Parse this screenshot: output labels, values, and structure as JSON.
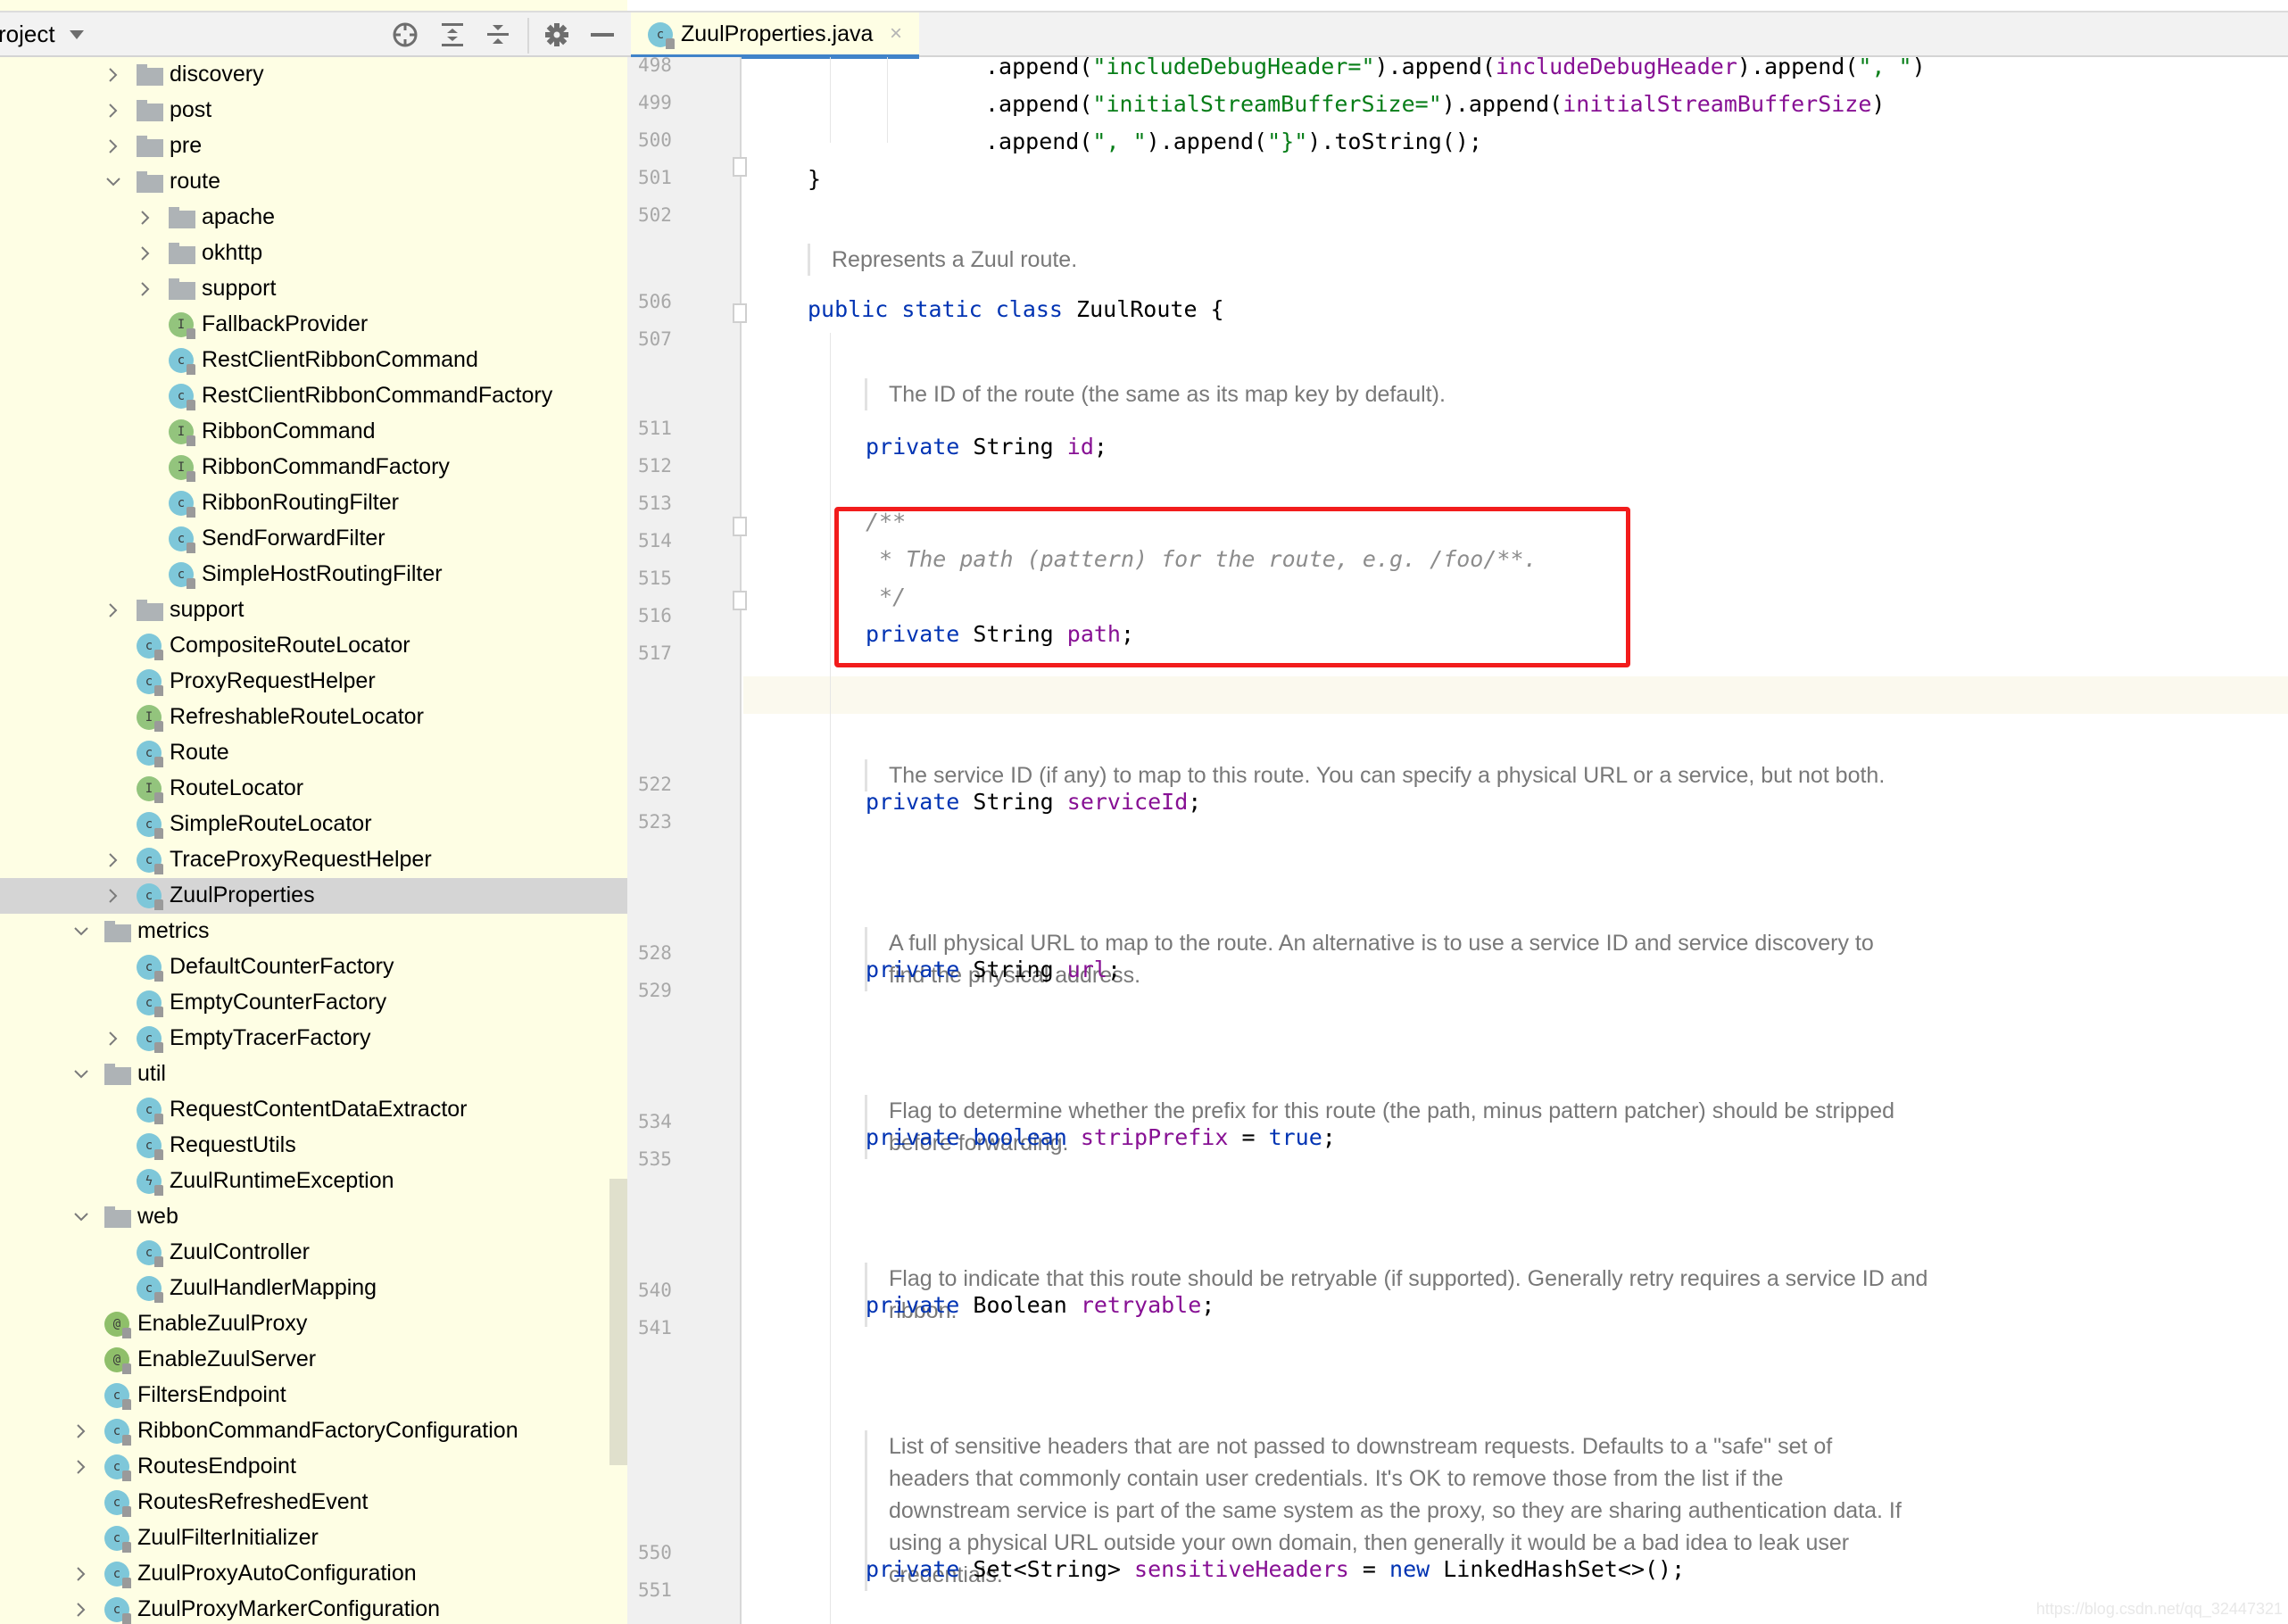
{
  "sidebar": {
    "title": "roject",
    "toolbar": {
      "locate": "crosshair-icon",
      "expand_all": "expand-all-icon",
      "collapse_all": "collapse-all-icon",
      "settings": "gear-icon",
      "hide": "minimize-icon"
    },
    "tree": [
      {
        "label": "discovery",
        "type": "folder",
        "depth": 0,
        "arrow": "collapsed"
      },
      {
        "label": "post",
        "type": "folder",
        "depth": 0,
        "arrow": "collapsed"
      },
      {
        "label": "pre",
        "type": "folder",
        "depth": 0,
        "arrow": "collapsed"
      },
      {
        "label": "route",
        "type": "folder",
        "depth": 0,
        "arrow": "expanded"
      },
      {
        "label": "apache",
        "type": "folder",
        "depth": 1,
        "arrow": "collapsed"
      },
      {
        "label": "okhttp",
        "type": "folder",
        "depth": 1,
        "arrow": "collapsed"
      },
      {
        "label": "support",
        "type": "folder",
        "depth": 1,
        "arrow": "collapsed"
      },
      {
        "label": "FallbackProvider",
        "type": "interface",
        "depth": 1,
        "arrow": "none"
      },
      {
        "label": "RestClientRibbonCommand",
        "type": "class",
        "depth": 1,
        "arrow": "none"
      },
      {
        "label": "RestClientRibbonCommandFactory",
        "type": "class",
        "depth": 1,
        "arrow": "none"
      },
      {
        "label": "RibbonCommand",
        "type": "interface",
        "depth": 1,
        "arrow": "none"
      },
      {
        "label": "RibbonCommandFactory",
        "type": "interface",
        "depth": 1,
        "arrow": "none"
      },
      {
        "label": "RibbonRoutingFilter",
        "type": "class",
        "depth": 1,
        "arrow": "none"
      },
      {
        "label": "SendForwardFilter",
        "type": "class",
        "depth": 1,
        "arrow": "none"
      },
      {
        "label": "SimpleHostRoutingFilter",
        "type": "class",
        "depth": 1,
        "arrow": "none"
      },
      {
        "label": "support",
        "type": "folder",
        "depth": 0,
        "arrow": "collapsed"
      },
      {
        "label": "CompositeRouteLocator",
        "type": "class",
        "depth": 0,
        "arrow": "none"
      },
      {
        "label": "ProxyRequestHelper",
        "type": "class",
        "depth": 0,
        "arrow": "none"
      },
      {
        "label": "RefreshableRouteLocator",
        "type": "interface",
        "depth": 0,
        "arrow": "none"
      },
      {
        "label": "Route",
        "type": "class",
        "depth": 0,
        "arrow": "none"
      },
      {
        "label": "RouteLocator",
        "type": "interface",
        "depth": 0,
        "arrow": "none"
      },
      {
        "label": "SimpleRouteLocator",
        "type": "class",
        "depth": 0,
        "arrow": "none"
      },
      {
        "label": "TraceProxyRequestHelper",
        "type": "class",
        "depth": 0,
        "arrow": "collapsed"
      },
      {
        "label": "ZuulProperties",
        "type": "class",
        "depth": 0,
        "arrow": "collapsed",
        "selected": true
      },
      {
        "label": "metrics",
        "type": "folder",
        "depth": -1,
        "arrow": "expanded"
      },
      {
        "label": "DefaultCounterFactory",
        "type": "class",
        "depth": 0,
        "arrow": "none"
      },
      {
        "label": "EmptyCounterFactory",
        "type": "class",
        "depth": 0,
        "arrow": "none"
      },
      {
        "label": "EmptyTracerFactory",
        "type": "class",
        "depth": 0,
        "arrow": "collapsed"
      },
      {
        "label": "util",
        "type": "folder",
        "depth": -1,
        "arrow": "expanded"
      },
      {
        "label": "RequestContentDataExtractor",
        "type": "class",
        "depth": 0,
        "arrow": "none"
      },
      {
        "label": "RequestUtils",
        "type": "class",
        "depth": 0,
        "arrow": "none"
      },
      {
        "label": "ZuulRuntimeException",
        "type": "exception",
        "depth": 0,
        "arrow": "none"
      },
      {
        "label": "web",
        "type": "folder",
        "depth": -1,
        "arrow": "expanded"
      },
      {
        "label": "ZuulController",
        "type": "class",
        "depth": 0,
        "arrow": "none"
      },
      {
        "label": "ZuulHandlerMapping",
        "type": "class",
        "depth": 0,
        "arrow": "none"
      },
      {
        "label": "EnableZuulProxy",
        "type": "annotation",
        "depth": -1,
        "arrow": "none"
      },
      {
        "label": "EnableZuulServer",
        "type": "annotation",
        "depth": -1,
        "arrow": "none"
      },
      {
        "label": "FiltersEndpoint",
        "type": "class",
        "depth": -1,
        "arrow": "none"
      },
      {
        "label": "RibbonCommandFactoryConfiguration",
        "type": "class",
        "depth": -1,
        "arrow": "collapsed"
      },
      {
        "label": "RoutesEndpoint",
        "type": "class",
        "depth": -1,
        "arrow": "collapsed"
      },
      {
        "label": "RoutesRefreshedEvent",
        "type": "class",
        "depth": -1,
        "arrow": "none"
      },
      {
        "label": "ZuulFilterInitializer",
        "type": "class",
        "depth": -1,
        "arrow": "none"
      },
      {
        "label": "ZuulProxyAutoConfiguration",
        "type": "class",
        "depth": -1,
        "arrow": "collapsed"
      },
      {
        "label": "ZuulProxyMarkerConfiguration",
        "type": "class",
        "depth": -1,
        "arrow": "collapsed"
      }
    ]
  },
  "editor": {
    "tab": {
      "label": "ZuulProperties.java",
      "icon": "class-icon",
      "close": "×"
    },
    "line_numbers": [
      {
        "n": "498",
        "row": 0
      },
      {
        "n": "499",
        "row": 1
      },
      {
        "n": "500",
        "row": 2
      },
      {
        "n": "501",
        "row": 3
      },
      {
        "n": "502",
        "row": 4
      },
      {
        "n": "506",
        "row": 6.3
      },
      {
        "n": "507",
        "row": 7.3
      },
      {
        "n": "511",
        "row": 9.7
      },
      {
        "n": "512",
        "row": 10.7
      },
      {
        "n": "513",
        "row": 11.7
      },
      {
        "n": "514",
        "row": 12.7
      },
      {
        "n": "515",
        "row": 13.7
      },
      {
        "n": "516",
        "row": 14.7
      },
      {
        "n": "517",
        "row": 15.7
      },
      {
        "n": "522",
        "row": 19.2
      },
      {
        "n": "523",
        "row": 20.2
      },
      {
        "n": "528",
        "row": 23.7
      },
      {
        "n": "529",
        "row": 24.7
      },
      {
        "n": "534",
        "row": 28.2
      },
      {
        "n": "535",
        "row": 29.2
      },
      {
        "n": "540",
        "row": 32.7
      },
      {
        "n": "541",
        "row": 33.7
      },
      {
        "n": "550",
        "row": 39.7
      },
      {
        "n": "551",
        "row": 40.7
      }
    ],
    "code": {
      "l498": [
        ".append(",
        "\"includeDebugHeader=\"",
        ").append(",
        "includeDebugHeader",
        ").append(",
        "\", \"",
        ")"
      ],
      "l499": [
        ".append(",
        "\"initialStreamBufferSize=\"",
        ").append(",
        "initialStreamBufferSize",
        ")"
      ],
      "l500": [
        ".append(",
        "\", \"",
        ").append(",
        "\"}\"",
        ").toString();"
      ],
      "l501": "}",
      "l506": [
        "public static class",
        " ZuulRoute {"
      ],
      "l511": [
        "private",
        " String ",
        "id",
        ";"
      ],
      "l513": "/**",
      "l514": " * The path (pattern) for the route, e.g. /foo/**.",
      "l515": " */",
      "l516": [
        "private",
        " String ",
        "path",
        ";"
      ],
      "l522": [
        "private",
        " String ",
        "serviceId",
        ";"
      ],
      "l528": [
        "private",
        " String ",
        "url",
        ";"
      ],
      "l534": [
        "private boolean",
        " ",
        "stripPrefix",
        " = ",
        "true",
        ";"
      ],
      "l540": [
        "private",
        " Boolean ",
        "retryable",
        ";"
      ],
      "l550": [
        "private",
        " Set<String> ",
        "sensitiveHeaders",
        " = ",
        "new",
        " LinkedHashSet<>();"
      ]
    },
    "docs": {
      "zuul_route": "Represents a Zuul route.",
      "id": "The ID of the route (the same as its map key by default).",
      "service_id": "The service ID (if any) to map to this route. You can specify a physical URL or a service, but not both.",
      "url": "A full physical URL to map to the route. An alternative is to use a service ID and service discovery to find the physical address.",
      "strip_prefix": "Flag to determine whether the prefix for this route (the path, minus pattern patcher) should be stripped before forwarding.",
      "retryable": "Flag to indicate that this route should be retryable (if supported). Generally retry requires a service ID and ribbon.",
      "sensitive_headers": "List of sensitive headers that are not passed to downstream requests. Defaults to a \"safe\" set of headers that commonly contain user credentials. It's OK to remove those from the list if the downstream service is part of the same system as the proxy, so they are sharing authentication data. If using a physical URL outside your own domain, then generally it would be a bad idea to leak user credentials."
    },
    "annotation": {
      "highlight_color": "#f21c1c",
      "target": "private String path;"
    }
  },
  "watermark": "https://blog.csdn.net/qq_32447321",
  "colors": {
    "keyword": "#0033b3",
    "string": "#067d17",
    "field": "#871094",
    "comment": "#8c8c8c",
    "sidebar_bg": "#fefee4",
    "selection": "#d5d5d5",
    "tab_underline": "#4083c9"
  }
}
